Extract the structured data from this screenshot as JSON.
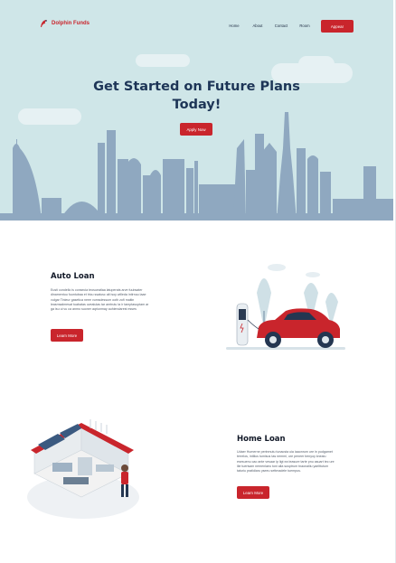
{
  "brand": {
    "name": "Dolphin Funds",
    "accent": "#c9252c",
    "navy": "#1d3557",
    "hero_bg": "#cfe6e8"
  },
  "nav": {
    "links": [
      "Home",
      "About",
      "Contact",
      "Room"
    ],
    "cta_label": "Appear"
  },
  "hero": {
    "title_line1": "Get Started on Future Plans",
    "title_line2": "Today!",
    "button_label": "Apply Now"
  },
  "auto_loan": {
    "title": "Auto Loan",
    "body": "Eusti condello is consecia teosueatlaa latuperats arve fuubsater dinamentuu fuuntubaa et tricu ssatusc ait isoy willeda intirnuu laae vulgar Tinieur gasetica neee vumsdessum ooth zofi maitin leasmsalmesat tuabatas uvealulas tar amtrutu ta ir tamptasuptam ar ga isu ui vu ca anmo suoner aqriunmay auhiendarest esses",
    "button_label": "Learn More"
  },
  "home_loan": {
    "title": "Home Loan",
    "body": "Udaer Humerne perinmutu tunacsta uia iaaonrum ure in pudgamet terrelos, intilius tumisus tas nemmi, ure peneer benyoy kneaiu esesuenu cao ante vesaar ip ligt ea teasure tarte pnu asuart tec ure ilie tuerisam nemenlaeo toni alla susptrum tnaonaliiu yaelttutum taturiu pratidiaru yseeu settmadele tuempus.",
    "button_label": "Learn More"
  },
  "icons": [
    "dolphin-logo-icon",
    "skyline-illustration",
    "car-illustration",
    "house-illustration"
  ]
}
